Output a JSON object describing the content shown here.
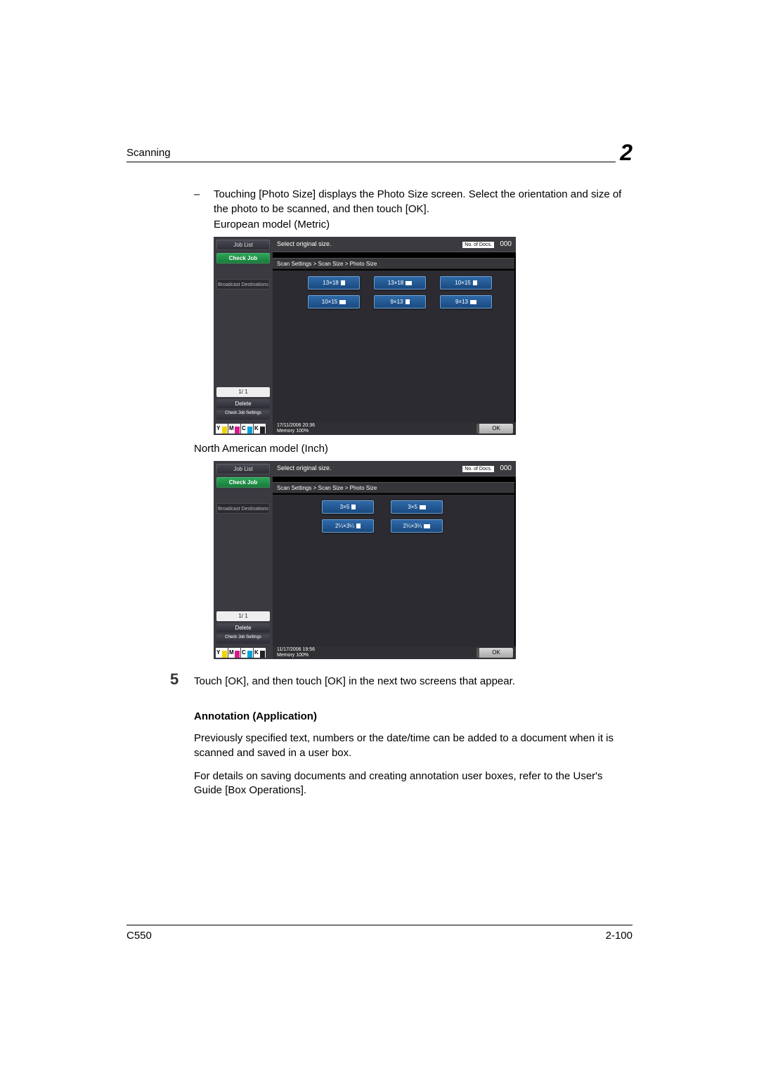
{
  "header": {
    "title": "Scanning",
    "chapter": "2"
  },
  "bullet": {
    "text": "Touching [Photo Size] displays the Photo Size screen. Select the orientation and size of the photo to be scanned, and then touch [OK]."
  },
  "caption1": "European model (Metric)",
  "caption2": "North American model (Inch)",
  "screen_metric": {
    "prompt": "Select original size.",
    "docs_label": "No. of Docs.",
    "docs_count": "000",
    "breadcrumb": "Scan Settings > Scan Size > Photo Size",
    "side": {
      "job_list": "Job List",
      "check_job": "Check Job",
      "broadcast": "Broadcast Destinations",
      "pager": "1/   1",
      "delete": "Delete",
      "check_set": "Check Job Settings"
    },
    "options_row1": [
      "13×18",
      "13×18",
      "10×15"
    ],
    "options_row2": [
      "10×15",
      "9×13",
      "9×13"
    ],
    "datetime": "17/11/2006   20:36",
    "memory": "Memory      100%",
    "ok": "OK",
    "toner": [
      "Y",
      "M",
      "C",
      "K"
    ]
  },
  "screen_inch": {
    "prompt": "Select original size.",
    "docs_label": "No. of Docs.",
    "docs_count": "000",
    "breadcrumb": "Scan Settings > Scan Size > Photo Size",
    "side": {
      "job_list": "Job List",
      "check_job": "Check Job",
      "broadcast": "Broadcast Destinations",
      "pager": "1/   1",
      "delete": "Delete",
      "check_set": "Check Job Settings"
    },
    "options_row1": [
      "3×5",
      "3×5"
    ],
    "options_row2": [
      "2¼×3¼",
      "2¼×3¼"
    ],
    "datetime": "11/17/2006   19:56",
    "memory": "Memory      100%",
    "ok": "OK",
    "toner": [
      "Y",
      "M",
      "C",
      "K"
    ]
  },
  "step": {
    "num": "5",
    "text": "Touch [OK], and then touch [OK] in the next two screens that appear."
  },
  "annotation": {
    "heading": "Annotation (Application)",
    "p1": "Previously specified text, numbers or the date/time can be added to a document when it is scanned and saved in a user box.",
    "p2": "For details on saving documents and creating annotation user boxes, refer to the User's Guide [Box Operations]."
  },
  "footer": {
    "model": "C550",
    "page": "2-100"
  },
  "toner_colors": {
    "Y": "#f2d200",
    "M": "#d61a8c",
    "C": "#00a3d6",
    "K": "#222"
  }
}
